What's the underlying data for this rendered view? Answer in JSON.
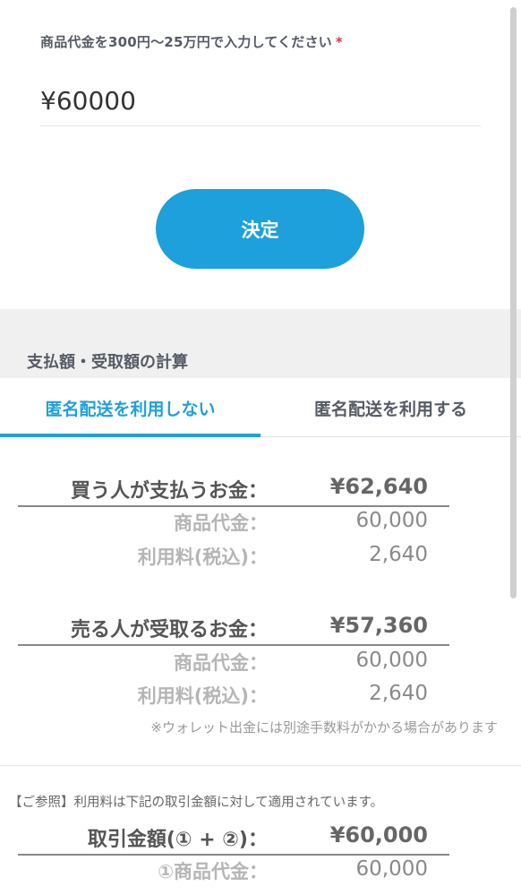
{
  "form": {
    "label": "商品代金を300円〜25万円で入力してください",
    "required_mark": "*",
    "price_value": "¥60000",
    "decide_label": "決定"
  },
  "calc": {
    "title": "支払額・受取額の計算",
    "tabs": [
      {
        "label": "匿名配送を利用しない",
        "active": true
      },
      {
        "label": "匿名配送を利用する",
        "active": false
      }
    ],
    "buyer": {
      "label": "買う人が支払うお金：",
      "total": "¥62,640",
      "items": [
        {
          "label": "商品代金：",
          "value": "60,000"
        },
        {
          "label": "利用料(税込)：",
          "value": "2,640"
        }
      ]
    },
    "seller": {
      "label": "売る人が受取るお金：",
      "total": "¥57,360",
      "items": [
        {
          "label": "商品代金：",
          "value": "60,000"
        },
        {
          "label": "利用料(税込)：",
          "value": "2,640"
        }
      ]
    },
    "wallet_note": "※ウォレット出金には別途手数料がかかる場合があります"
  },
  "reference": {
    "note": "【ご参照】利用料は下記の取引金額に対して適用されています。",
    "transaction_label": "取引金額(① + ②)：",
    "transaction_total": "¥60,000",
    "items": [
      {
        "label": "①商品代金：",
        "value": "60,000"
      }
    ]
  },
  "colors": {
    "accent": "#1ea0dc",
    "required": "#e0334b"
  }
}
